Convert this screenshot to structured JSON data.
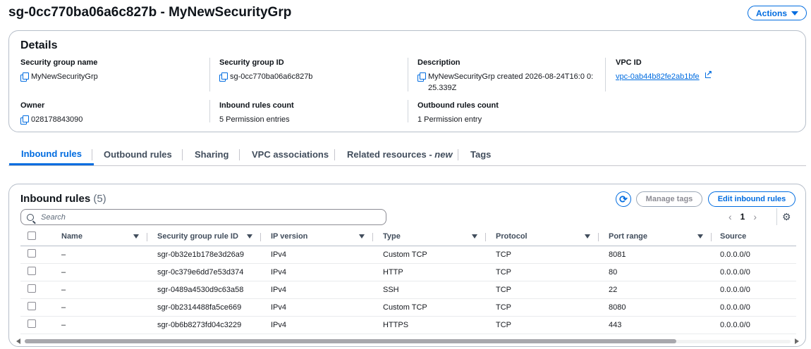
{
  "header": {
    "title": "sg-0cc770ba06a6c827b - MyNewSecurityGrp",
    "actions_label": "Actions"
  },
  "details": {
    "title": "Details",
    "sg_name_label": "Security group name",
    "sg_name": "MyNewSecurityGrp",
    "sg_id_label": "Security group ID",
    "sg_id": "sg-0cc770ba06a6c827b",
    "description_label": "Description",
    "description": "MyNewSecurityGrp created 2026-08-24T16:0 0:25.339Z",
    "vpc_id_label": "VPC ID",
    "vpc_id": "vpc-0ab44b82fe2ab1bfe",
    "owner_label": "Owner",
    "owner": "028178843090",
    "inbound_count_label": "Inbound rules count",
    "inbound_count": "5 Permission entries",
    "outbound_count_label": "Outbound rules count",
    "outbound_count": "1 Permission entry"
  },
  "tabs": [
    {
      "label": "Inbound rules",
      "active": true
    },
    {
      "label": "Outbound rules"
    },
    {
      "label": "Sharing"
    },
    {
      "label": "VPC associations"
    },
    {
      "label": "Related resources - ",
      "suffix": "new"
    },
    {
      "label": "Tags"
    }
  ],
  "rules": {
    "title": "Inbound rules",
    "count": "(5)",
    "manage_tags_label": "Manage tags",
    "edit_label": "Edit inbound rules",
    "search_placeholder": "Search",
    "page": "1",
    "columns": [
      "Name",
      "Security group rule ID",
      "IP version",
      "Type",
      "Protocol",
      "Port range",
      "Source"
    ],
    "rows": [
      {
        "name": "–",
        "id": "sgr-0b32e1b178e3d26a9",
        "ip": "IPv4",
        "type": "Custom TCP",
        "protocol": "TCP",
        "port": "8081",
        "source": "0.0.0.0/0"
      },
      {
        "name": "–",
        "id": "sgr-0c379e6dd7e53d374",
        "ip": "IPv4",
        "type": "HTTP",
        "protocol": "TCP",
        "port": "80",
        "source": "0.0.0.0/0"
      },
      {
        "name": "–",
        "id": "sgr-0489a4530d9c63a58",
        "ip": "IPv4",
        "type": "SSH",
        "protocol": "TCP",
        "port": "22",
        "source": "0.0.0.0/0"
      },
      {
        "name": "–",
        "id": "sgr-0b2314488fa5ce669",
        "ip": "IPv4",
        "type": "Custom TCP",
        "protocol": "TCP",
        "port": "8080",
        "source": "0.0.0.0/0"
      },
      {
        "name": "–",
        "id": "sgr-0b6b8273fd04c3229",
        "ip": "IPv4",
        "type": "HTTPS",
        "protocol": "TCP",
        "port": "443",
        "source": "0.0.0.0/0"
      }
    ]
  },
  "colors": {
    "accent": "#006ce0",
    "text": "#16191f",
    "border": "#b6bec9"
  }
}
